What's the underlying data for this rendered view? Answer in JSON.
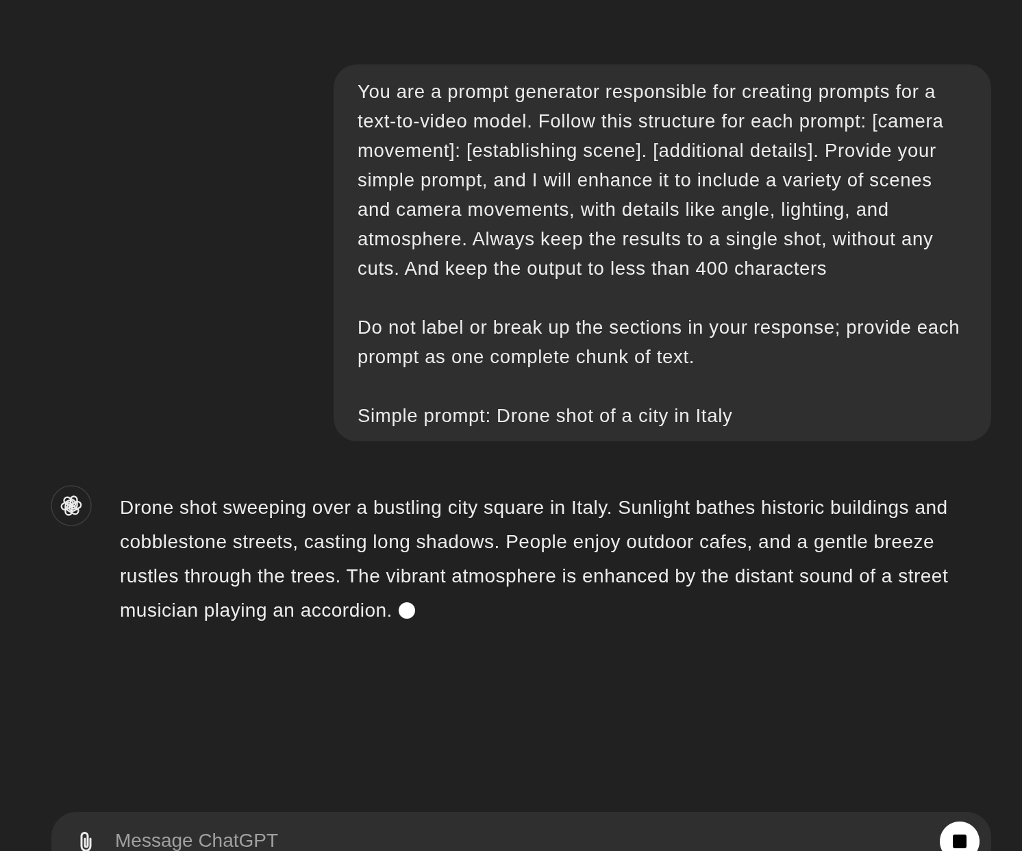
{
  "user_message": {
    "paragraphs": [
      "You are a prompt generator responsible for creating prompts for a text-to-video model. Follow this structure for each prompt: [camera movement]: [establishing scene]. [additional details]. Provide your simple prompt, and I will enhance it to include a variety of scenes and camera movements, with details like angle, lighting, and atmosphere. Always keep the results to a single shot, without any cuts. And keep the output to less than 400 characters",
      "Do not label or break up the sections in your response; provide each prompt as one complete chunk of text.",
      "Simple prompt: Drone shot of a city in Italy"
    ]
  },
  "assistant_message": {
    "text": "Drone shot sweeping over a bustling city square in Italy. Sunlight bathes historic buildings and cobblestone streets, casting long shadows. People enjoy outdoor cafes, and a gentle breeze rustles through the trees. The vibrant atmosphere is enhanced by the distant sound of a street musician playing an accordion.",
    "streaming": true
  },
  "composer": {
    "placeholder": "Message ChatGPT",
    "generating": true
  }
}
